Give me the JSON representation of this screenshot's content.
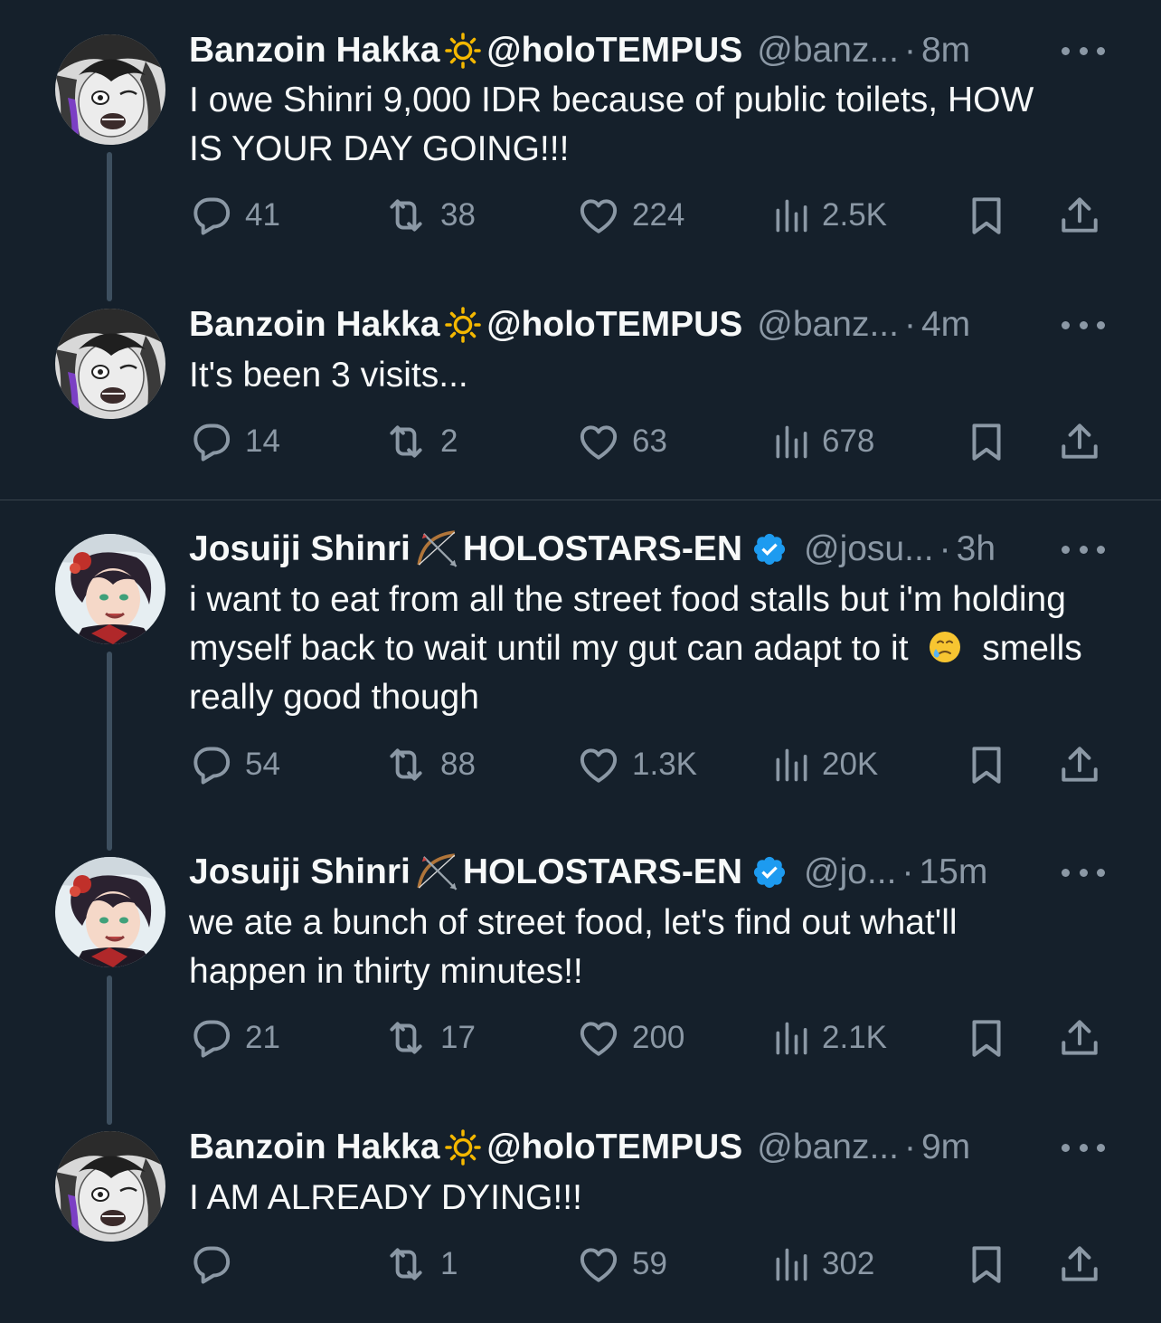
{
  "tweets": [
    {
      "name": "Banzoin Hakka",
      "name_suffix": "@holoTEMPUS",
      "handle": "@banz...",
      "time": "8m",
      "text": "I owe Shinri 9,000 IDR because of public toilets, HOW IS YOUR DAY GOING!!!",
      "replies": "41",
      "retweets": "38",
      "likes": "224",
      "views": "2.5K",
      "avatar": "banzoin-avatar",
      "name_icon": "sun-icon",
      "verified": false
    },
    {
      "name": "Banzoin Hakka",
      "name_suffix": "@holoTEMPUS",
      "handle": "@banz...",
      "time": "4m",
      "text": "It's been 3 visits...",
      "replies": "14",
      "retweets": "2",
      "likes": "63",
      "views": "678",
      "avatar": "banzoin-avatar",
      "name_icon": "sun-icon",
      "verified": false
    },
    {
      "name": "Josuiji Shinri",
      "name_suffix": "HOLOSTARS-EN",
      "handle": "@josu...",
      "time": "3h",
      "text_parts": [
        "i want to eat from all the street food stalls but i'm holding myself back to wait until my gut can adapt to it",
        "smells really good though"
      ],
      "text_emoji": "holding-back-tears-emoji",
      "replies": "54",
      "retweets": "88",
      "likes": "1.3K",
      "views": "20K",
      "avatar": "shinri-avatar",
      "name_icon": "bow-and-arrow-icon",
      "verified": true
    },
    {
      "name": "Josuiji Shinri",
      "name_suffix": "HOLOSTARS-EN",
      "handle": "@jo...",
      "time": "15m",
      "text": "we ate a bunch of street food, let's find out what'll happen in thirty minutes!!",
      "replies": "21",
      "retweets": "17",
      "likes": "200",
      "views": "2.1K",
      "avatar": "shinri-avatar",
      "name_icon": "bow-and-arrow-icon",
      "verified": true
    },
    {
      "name": "Banzoin Hakka",
      "name_suffix": "@holoTEMPUS",
      "handle": "@banz...",
      "time": "9m",
      "text": "I AM ALREADY DYING!!!",
      "replies": "",
      "retweets": "1",
      "likes": "59",
      "views": "302",
      "avatar": "banzoin-avatar",
      "name_icon": "sun-icon",
      "verified": false
    }
  ],
  "separator": "·",
  "colors": {
    "background": "#15202b",
    "text": "#f7f9f9",
    "secondary": "#8b98a5",
    "verified": "#1d9bf0",
    "thread_line": "#3d4f5f"
  }
}
